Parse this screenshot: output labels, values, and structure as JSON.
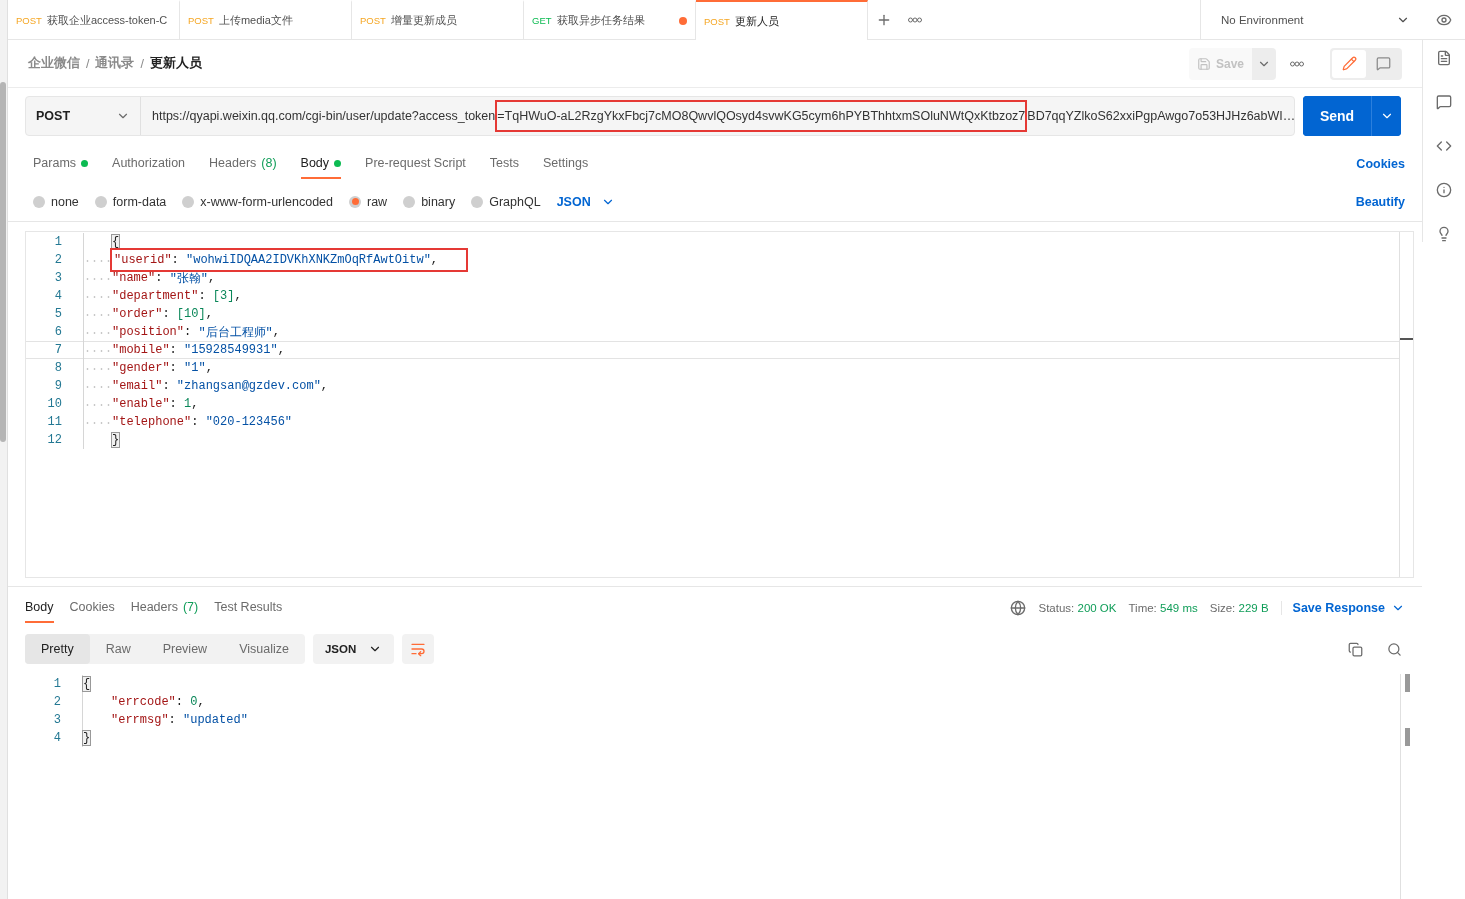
{
  "tabs": [
    {
      "method": "POST",
      "title": "获取企业access-token-C",
      "selected": false,
      "unsaved": false
    },
    {
      "method": "POST",
      "title": "上传media文件",
      "selected": false,
      "unsaved": false
    },
    {
      "method": "POST",
      "title": "增量更新成员",
      "selected": false,
      "unsaved": false
    },
    {
      "method": "GET",
      "title": "获取异步任务结果",
      "selected": false,
      "unsaved": true
    },
    {
      "method": "POST",
      "title": "更新人员",
      "selected": true,
      "unsaved": false
    }
  ],
  "environment": "No Environment",
  "breadcrumb": [
    {
      "text": "企业微信"
    },
    {
      "separator": "/",
      "text": "通讯录"
    },
    {
      "separator": "/",
      "text": "更新人员"
    }
  ],
  "save_button": {
    "label": "Save",
    "disabled": true
  },
  "request": {
    "method": "POST",
    "url_parts": [
      {
        "text": "https://qyapi.weixin.qq.com/cgi-bin/user/update?access_token",
        "highlighted": false
      },
      {
        "text": "=TqHWuO-aL2RzgYkxFbcj7cMO8QwvlQOsyd4svwKG5cym6hPYBThhtxmSOluNWtQxKtbzoz7",
        "highlighted": true
      },
      {
        "text": "BD7qqYZlkoS62xxiPgpAwgo7o53HJHz6abWI…",
        "highlighted": false
      }
    ],
    "send": "Send"
  },
  "request_tabs": [
    {
      "label": "Params",
      "dot": true,
      "selected": false
    },
    {
      "label": "Authorization",
      "dot": false,
      "selected": false
    },
    {
      "label": "Headers",
      "count": "(8)",
      "dot": false,
      "selected": false
    },
    {
      "label": "Body",
      "dot": true,
      "selected": true
    },
    {
      "label": "Pre-request Script",
      "dot": false,
      "selected": false
    },
    {
      "label": "Tests",
      "dot": false,
      "selected": false
    },
    {
      "label": "Settings",
      "dot": false,
      "selected": false
    }
  ],
  "cookies_link": "Cookies",
  "body_types": [
    {
      "label": "none",
      "selected": false
    },
    {
      "label": "form-data",
      "selected": false
    },
    {
      "label": "x-www-form-urlencoded",
      "selected": false
    },
    {
      "label": "raw",
      "selected": true
    },
    {
      "label": "binary",
      "selected": false
    },
    {
      "label": "GraphQL",
      "selected": false
    }
  ],
  "language": "JSON",
  "beautify": "Beautify",
  "request_body": [
    {
      "number": "1",
      "indented": false,
      "current": false,
      "highlighted": false,
      "tokens": [
        {
          "text": "{",
          "kind": "brace"
        }
      ]
    },
    {
      "number": "2",
      "indented": true,
      "current": false,
      "highlighted": true,
      "tokens": [
        {
          "text": "\"userid\"",
          "kind": "key"
        },
        {
          "text": ": ",
          "kind": "punct"
        },
        {
          "text": "\"wohwiIDQAA2IDVKhXNKZmOqRfAwtOitw\"",
          "kind": "string"
        },
        {
          "text": ",",
          "kind": "punct"
        }
      ]
    },
    {
      "number": "3",
      "indented": true,
      "current": false,
      "highlighted": false,
      "tokens": [
        {
          "text": "\"name\"",
          "kind": "key"
        },
        {
          "text": ": ",
          "kind": "punct"
        },
        {
          "text": "\"张翰\"",
          "kind": "string"
        },
        {
          "text": ",",
          "kind": "punct"
        }
      ]
    },
    {
      "number": "4",
      "indented": true,
      "current": false,
      "highlighted": false,
      "tokens": [
        {
          "text": "\"department\"",
          "kind": "key"
        },
        {
          "text": ": ",
          "kind": "punct"
        },
        {
          "text": "[3]",
          "kind": "number"
        },
        {
          "text": ",",
          "kind": "punct"
        }
      ]
    },
    {
      "number": "5",
      "indented": true,
      "current": false,
      "highlighted": false,
      "tokens": [
        {
          "text": "\"order\"",
          "kind": "key"
        },
        {
          "text": ": ",
          "kind": "punct"
        },
        {
          "text": "[10]",
          "kind": "number"
        },
        {
          "text": ",",
          "kind": "punct"
        }
      ]
    },
    {
      "number": "6",
      "indented": true,
      "current": false,
      "highlighted": false,
      "tokens": [
        {
          "text": "\"position\"",
          "kind": "key"
        },
        {
          "text": ": ",
          "kind": "punct"
        },
        {
          "text": "\"后台工程师\"",
          "kind": "string"
        },
        {
          "text": ",",
          "kind": "punct"
        }
      ]
    },
    {
      "number": "7",
      "indented": true,
      "current": true,
      "highlighted": false,
      "tokens": [
        {
          "text": "\"mobile\"",
          "kind": "key"
        },
        {
          "text": ": ",
          "kind": "punct"
        },
        {
          "text": "\"15928549931\"",
          "kind": "string"
        },
        {
          "text": ",",
          "kind": "punct"
        }
      ]
    },
    {
      "number": "8",
      "indented": true,
      "current": false,
      "highlighted": false,
      "tokens": [
        {
          "text": "\"gender\"",
          "kind": "key"
        },
        {
          "text": ": ",
          "kind": "punct"
        },
        {
          "text": "\"1\"",
          "kind": "string"
        },
        {
          "text": ",",
          "kind": "punct"
        }
      ]
    },
    {
      "number": "9",
      "indented": true,
      "current": false,
      "highlighted": false,
      "tokens": [
        {
          "text": "\"email\"",
          "kind": "key"
        },
        {
          "text": ": ",
          "kind": "punct"
        },
        {
          "text": "\"zhangsan@gzdev.com\"",
          "kind": "string"
        },
        {
          "text": ",",
          "kind": "punct"
        }
      ]
    },
    {
      "number": "10",
      "indented": true,
      "current": false,
      "highlighted": false,
      "tokens": [
        {
          "text": "\"enable\"",
          "kind": "key"
        },
        {
          "text": ": ",
          "kind": "punct"
        },
        {
          "text": "1",
          "kind": "number"
        },
        {
          "text": ",",
          "kind": "punct"
        }
      ]
    },
    {
      "number": "11",
      "indented": true,
      "current": false,
      "highlighted": false,
      "tokens": [
        {
          "text": "\"telephone\"",
          "kind": "key"
        },
        {
          "text": ": ",
          "kind": "punct"
        },
        {
          "text": "\"020-123456\"",
          "kind": "string"
        }
      ]
    },
    {
      "number": "12",
      "indented": false,
      "current": false,
      "highlighted": false,
      "tokens": [
        {
          "text": "}",
          "kind": "brace"
        }
      ]
    }
  ],
  "response_tabs": [
    {
      "label": "Body",
      "selected": true
    },
    {
      "label": "Cookies",
      "selected": false
    },
    {
      "label": "Headers",
      "count": "(7)",
      "selected": false
    },
    {
      "label": "Test Results",
      "selected": false
    }
  ],
  "response_stats": [
    {
      "label": "Status:",
      "value": "200 OK"
    },
    {
      "label": "Time:",
      "value": "549 ms"
    },
    {
      "label": "Size:",
      "value": "229 B"
    }
  ],
  "save_response": "Save Response",
  "view_modes": [
    {
      "label": "Pretty",
      "selected": true
    },
    {
      "label": "Raw",
      "selected": false
    },
    {
      "label": "Preview",
      "selected": false
    },
    {
      "label": "Visualize",
      "selected": false
    }
  ],
  "response_format": "JSON",
  "response_body": [
    {
      "number": "1",
      "indented": false,
      "tokens": [
        {
          "text": "{",
          "kind": "brace"
        }
      ]
    },
    {
      "number": "2",
      "indented": true,
      "tokens": [
        {
          "text": "\"errcode\"",
          "kind": "key"
        },
        {
          "text": ": ",
          "kind": "punct"
        },
        {
          "text": "0",
          "kind": "number"
        },
        {
          "text": ",",
          "kind": "punct"
        }
      ]
    },
    {
      "number": "3",
      "indented": true,
      "tokens": [
        {
          "text": "\"errmsg\"",
          "kind": "key"
        },
        {
          "text": ": ",
          "kind": "punct"
        },
        {
          "text": "\"updated\"",
          "kind": "string"
        }
      ]
    },
    {
      "number": "4",
      "indented": false,
      "tokens": [
        {
          "text": "}",
          "kind": "brace"
        }
      ]
    }
  ]
}
